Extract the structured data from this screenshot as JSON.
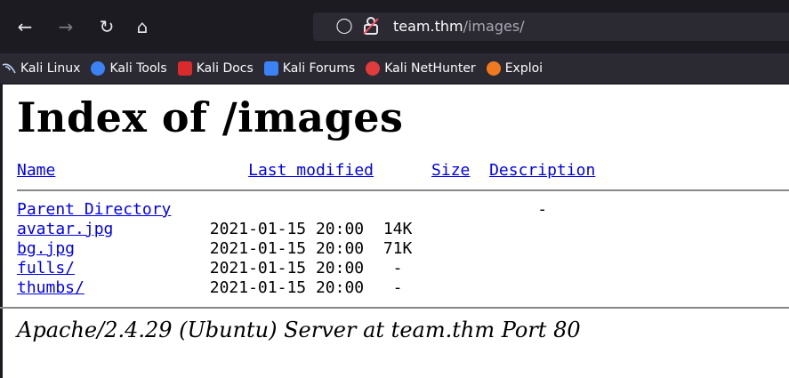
{
  "browser": {
    "url_host": "team.thm",
    "url_path": "/images/",
    "bookmarks": [
      {
        "label": "Kali Linux",
        "icon": "kali-dragon-icon",
        "color": "#8fb4e8"
      },
      {
        "label": "Kali Tools",
        "icon": "kali-tools-icon",
        "color": "#3b82f6"
      },
      {
        "label": "Kali Docs",
        "icon": "kali-docs-icon",
        "color": "#d92b2b"
      },
      {
        "label": "Kali Forums",
        "icon": "kali-forums-icon",
        "color": "#3b82f6"
      },
      {
        "label": "Kali NetHunter",
        "icon": "kali-nethunter-icon",
        "color": "#e23b3b"
      },
      {
        "label": "Exploi",
        "icon": "exploit-db-icon",
        "color": "#f07a1e"
      }
    ]
  },
  "page": {
    "title": "Index of /images",
    "headers": {
      "name": "Name",
      "last_modified": "Last modified",
      "size": "Size",
      "description": "Description"
    },
    "rows": [
      {
        "name": "Parent Directory",
        "modified": "",
        "size": "-"
      },
      {
        "name": "avatar.jpg",
        "modified": "2021-01-15 20:00",
        "size": "14K"
      },
      {
        "name": "bg.jpg",
        "modified": "2021-01-15 20:00",
        "size": "71K"
      },
      {
        "name": "fulls/",
        "modified": "2021-01-15 20:00",
        "size": "-"
      },
      {
        "name": "thumbs/",
        "modified": "2021-01-15 20:00",
        "size": "-"
      }
    ],
    "footer": "Apache/2.4.29 (Ubuntu) Server at team.thm Port 80"
  }
}
